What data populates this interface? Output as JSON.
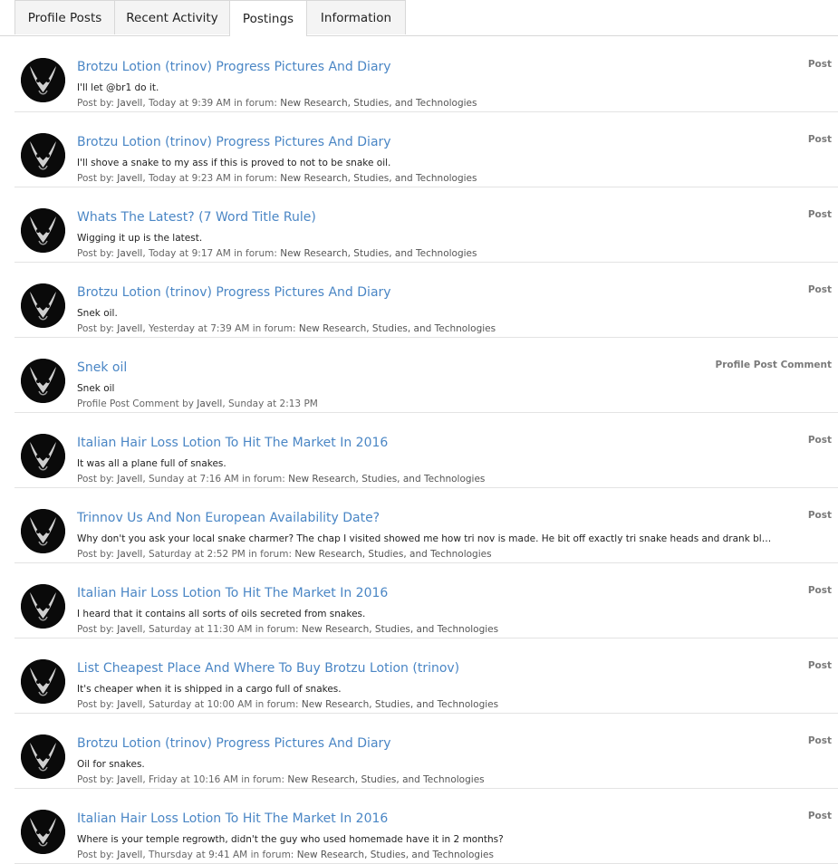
{
  "tabs": [
    {
      "label": "Profile Posts"
    },
    {
      "label": "Recent Activity"
    },
    {
      "label": "Postings"
    },
    {
      "label": "Information"
    }
  ],
  "active_tab": "Postings",
  "items": [
    {
      "title": "Brotzu Lotion (trinov) Progress Pictures And Diary",
      "snippet": "I'll let @br1 do it.",
      "meta_prefix": "Post by: ",
      "author": "Javell",
      "meta_time": ", Today at 9:39 AM",
      "meta_forum_prefix": " in forum: ",
      "forum": "New Research, Studies, and Technologies",
      "type": "Post"
    },
    {
      "title": "Brotzu Lotion (trinov) Progress Pictures And Diary",
      "snippet": "I'll shove a snake to my ass if this is proved to not to be snake oil.",
      "meta_prefix": "Post by: ",
      "author": "Javell",
      "meta_time": ", Today at 9:23 AM",
      "meta_forum_prefix": " in forum: ",
      "forum": "New Research, Studies, and Technologies",
      "type": "Post"
    },
    {
      "title": "Whats The Latest? (7 Word Title Rule)",
      "snippet": "Wigging it up is the latest.",
      "meta_prefix": "Post by: ",
      "author": "Javell",
      "meta_time": ", Today at 9:17 AM",
      "meta_forum_prefix": " in forum: ",
      "forum": "New Research, Studies, and Technologies",
      "type": "Post"
    },
    {
      "title": "Brotzu Lotion (trinov) Progress Pictures And Diary",
      "snippet": "Snek oil.",
      "meta_prefix": "Post by: ",
      "author": "Javell",
      "meta_time": ", Yesterday at 7:39 AM",
      "meta_forum_prefix": " in forum: ",
      "forum": "New Research, Studies, and Technologies",
      "type": "Post"
    },
    {
      "title": "Snek oil",
      "snippet": "Snek oil",
      "meta_prefix": "Profile Post Comment by ",
      "author": "Javell",
      "meta_time": ", Sunday at 2:13 PM",
      "meta_forum_prefix": "",
      "forum": "",
      "type": "Profile Post Comment"
    },
    {
      "title": "Italian Hair Loss Lotion To Hit The Market In 2016",
      "snippet": "It was all a plane full of snakes.",
      "meta_prefix": "Post by: ",
      "author": "Javell",
      "meta_time": ", Sunday at 7:16 AM",
      "meta_forum_prefix": " in forum: ",
      "forum": "New Research, Studies, and Technologies",
      "type": "Post"
    },
    {
      "title": "Trinnov Us And Non European Availability Date?",
      "snippet": "Why don't you ask your local snake charmer? The chap I visited showed me how tri nov is made. He bit off exactly tri snake heads and drank blood...",
      "meta_prefix": "Post by: ",
      "author": "Javell",
      "meta_time": ", Saturday at 2:52 PM",
      "meta_forum_prefix": " in forum: ",
      "forum": "New Research, Studies, and Technologies",
      "type": "Post"
    },
    {
      "title": "Italian Hair Loss Lotion To Hit The Market In 2016",
      "snippet": "I heard that it contains all sorts of oils secreted from snakes.",
      "meta_prefix": "Post by: ",
      "author": "Javell",
      "meta_time": ", Saturday at 11:30 AM",
      "meta_forum_prefix": " in forum: ",
      "forum": "New Research, Studies, and Technologies",
      "type": "Post"
    },
    {
      "title": "List Cheapest Place And Where To Buy Brotzu Lotion (trinov)",
      "snippet": "It's cheaper when it is shipped in a cargo full of snakes.",
      "meta_prefix": "Post by: ",
      "author": "Javell",
      "meta_time": ", Saturday at 10:00 AM",
      "meta_forum_prefix": " in forum: ",
      "forum": "New Research, Studies, and Technologies",
      "type": "Post"
    },
    {
      "title": "Brotzu Lotion (trinov) Progress Pictures And Diary",
      "snippet": "Oil for snakes.",
      "meta_prefix": "Post by: ",
      "author": "Javell",
      "meta_time": ", Friday at 10:16 AM",
      "meta_forum_prefix": " in forum: ",
      "forum": "New Research, Studies, and Technologies",
      "type": "Post"
    },
    {
      "title": "Italian Hair Loss Lotion To Hit The Market In 2016",
      "snippet": "Where is your temple regrowth, didn't the guy who used homemade have it in 2 months?",
      "meta_prefix": "Post by: ",
      "author": "Javell",
      "meta_time": ", Thursday at 9:41 AM",
      "meta_forum_prefix": " in forum: ",
      "forum": "New Research, Studies, and Technologies",
      "type": "Post"
    }
  ],
  "colors": {
    "link": "#4a86c5",
    "type_label": "#7a7a7a",
    "border": "#d8d8d8"
  }
}
